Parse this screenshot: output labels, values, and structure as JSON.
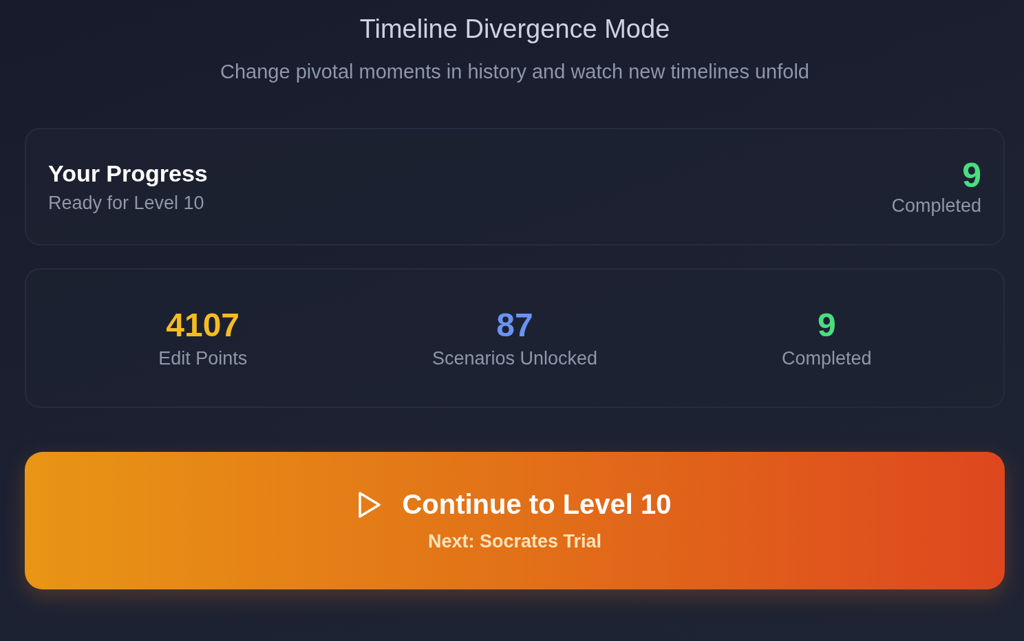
{
  "header": {
    "title": "Timeline Divergence Mode",
    "subtitle": "Change pivotal moments in history and watch new timelines unfold"
  },
  "progress": {
    "title": "Your Progress",
    "subtitle": "Ready for Level 10",
    "count": "9",
    "count_label": "Completed"
  },
  "stats": [
    {
      "value": "4107",
      "label": "Edit Points",
      "color": "#f5bc22"
    },
    {
      "value": "87",
      "label": "Scenarios Unlocked",
      "color": "#6b93f5"
    },
    {
      "value": "9",
      "label": "Completed",
      "color": "#4ade80"
    }
  ],
  "continue_button": {
    "label": "Continue to Level 10",
    "next": "Next: Socrates Trial"
  }
}
